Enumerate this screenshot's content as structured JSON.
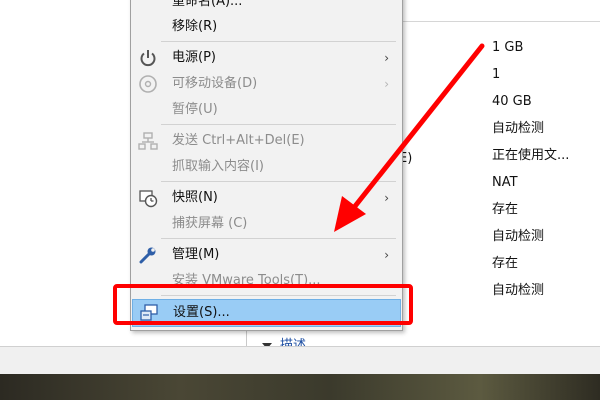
{
  "colors": {
    "accent_red": "#ff0000",
    "selection": "#99ccf5",
    "menu_bg": "#f2f2f2"
  },
  "menu": {
    "items": [
      {
        "label": "重命名(A)...",
        "disabled": false,
        "icon": ""
      },
      {
        "label": "移除(R)",
        "disabled": false,
        "icon": ""
      },
      {
        "label": "电源(P)",
        "disabled": false,
        "icon": "power-icon",
        "submenu": true
      },
      {
        "label": "可移动设备(D)",
        "disabled": true,
        "icon": "disc-icon",
        "submenu": true
      },
      {
        "label": "暂停(U)",
        "disabled": true,
        "icon": ""
      },
      {
        "label": "发送 Ctrl+Alt+Del(E)",
        "disabled": true,
        "icon": "network-icon"
      },
      {
        "label": "抓取输入内容(I)",
        "disabled": true,
        "icon": ""
      },
      {
        "label": "快照(N)",
        "disabled": false,
        "icon": "snapshot-icon",
        "submenu": true
      },
      {
        "label": "捕获屏幕 (C)",
        "disabled": true,
        "icon": ""
      },
      {
        "label": "管理(M)",
        "disabled": false,
        "icon": "wrench-icon",
        "submenu": true
      },
      {
        "label": "安装 VMware Tools(T)...",
        "disabled": true,
        "icon": ""
      },
      {
        "label": "设置(S)...",
        "disabled": false,
        "icon": "settings-icon",
        "selected": true
      }
    ],
    "submenu_arrow": "›"
  },
  "devices": {
    "paren_fragment": "E)",
    "values": [
      "1 GB",
      "1",
      "40 GB",
      "自动检测",
      "正在使用文...",
      "NAT",
      "存在",
      "自动检测",
      "存在",
      "自动检测"
    ]
  },
  "description_section": {
    "label": "描述"
  }
}
